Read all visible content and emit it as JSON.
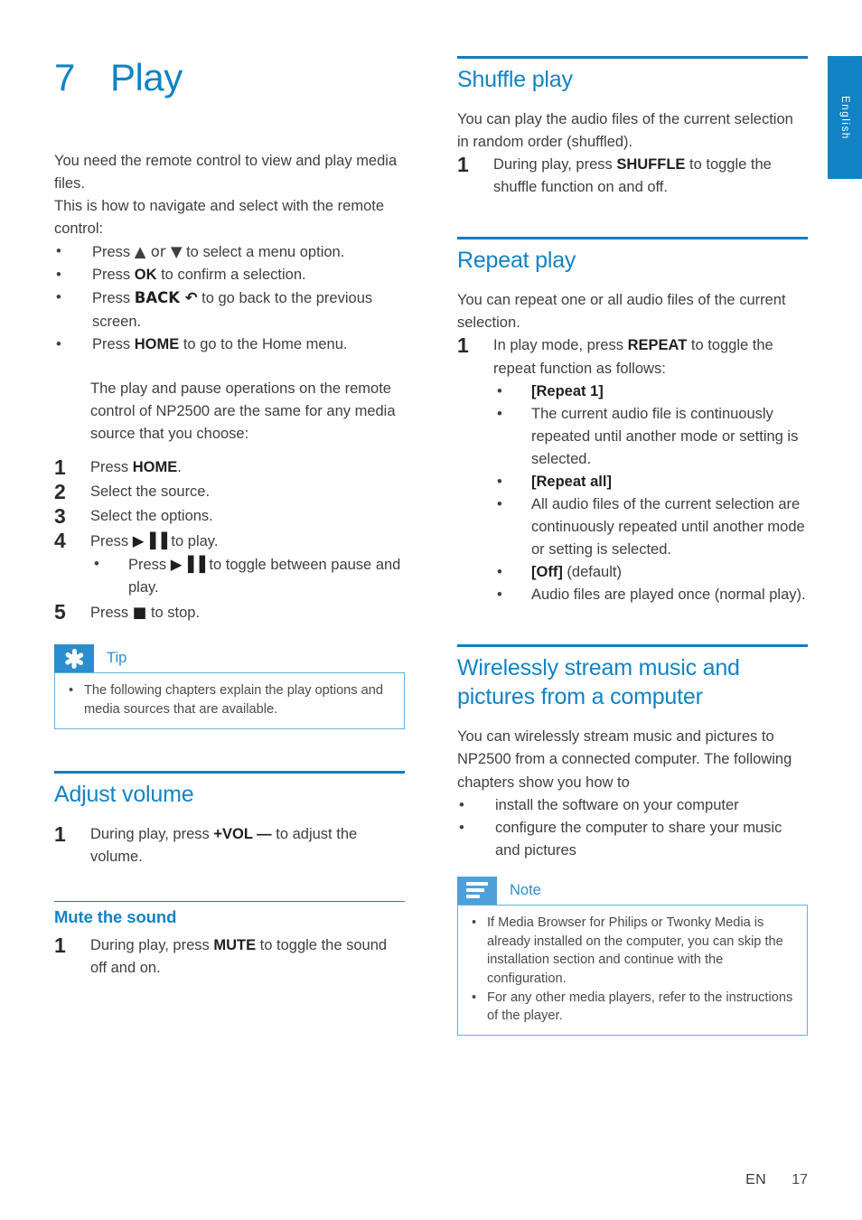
{
  "colors": {
    "accent_blue": "#1283c4",
    "rule_blue": "#0f7cc0",
    "callout_icon_blue": "#4f9fd8",
    "callout_border": "#6aaedd",
    "body_text": "#3f3f3f"
  },
  "chapter": {
    "number": "7",
    "title": "Play"
  },
  "language_tab": {
    "label": "English"
  },
  "footer": {
    "language_code": "EN",
    "page_number": "17"
  },
  "left_column": {
    "intro": {
      "paragraph_1": "You need the remote control to view and play media files.",
      "paragraph_2": "This is how to navigate and select with the remote control:"
    },
    "nav_bullets": [
      {
        "prefix": "Press ",
        "key": "▲ or ▼",
        "key_bold": false,
        "suffix": " to select a menu option."
      },
      {
        "prefix": "Press ",
        "key": "OK",
        "key_bold": true,
        "suffix": " to confirm a selection."
      },
      {
        "prefix": "Press ",
        "key": "BACK ↶",
        "key_bold": true,
        "suffix": " to go back to the previous screen."
      },
      {
        "prefix": "Press ",
        "key": "HOME",
        "key_bold": true,
        "suffix": " to go to the Home menu."
      }
    ],
    "note_paragraph": "The play and pause operations on the remote control of NP2500 are the same for any media source that you choose:",
    "steps": [
      {
        "num": "1",
        "prefix": "Press ",
        "key": "HOME",
        "key_bold": true,
        "suffix": "."
      },
      {
        "num": "2",
        "prefix": "Select the source.",
        "key": "",
        "key_bold": false,
        "suffix": ""
      },
      {
        "num": "3",
        "prefix": "Select the options.",
        "key": "",
        "key_bold": false,
        "suffix": ""
      },
      {
        "num": "4",
        "prefix": "Press ",
        "key": "▶▐▐",
        "key_bold": true,
        "suffix": " to play."
      },
      {
        "num": "5",
        "prefix": "Press ",
        "key": "■",
        "key_bold": true,
        "suffix": " to stop."
      }
    ],
    "step4_sub_bullet": {
      "prefix": "Press ",
      "key": "▶▐▐",
      "suffix": " to toggle between pause and play."
    },
    "tip_box": {
      "icon": "asterisk-icon",
      "label": "Tip",
      "items": [
        "The following chapters explain the play options and media sources that are available."
      ]
    },
    "adjust_volume": {
      "heading": "Adjust volume",
      "steps": [
        {
          "num": "1",
          "prefix": "During play, press ",
          "key": "+VOL —",
          "key_bold": true,
          "suffix": " to adjust the volume."
        }
      ]
    },
    "mute_the_sound": {
      "heading": "Mute the sound",
      "steps": [
        {
          "num": "1",
          "prefix": "During play, press ",
          "key": "MUTE",
          "key_bold": true,
          "suffix": " to toggle the sound off and on."
        }
      ]
    }
  },
  "right_column": {
    "shuffle_play": {
      "heading": "Shuffle play",
      "paragraph": "You can play the audio files of the current selection in random order (shuffled).",
      "steps": [
        {
          "num": "1",
          "prefix": "During play, press ",
          "key": "SHUFFLE",
          "key_bold": true,
          "suffix": " to toggle the shuffle function on and off."
        }
      ]
    },
    "repeat_play": {
      "heading": "Repeat play",
      "paragraph": "You can repeat one or all audio files of the current selection.",
      "steps": [
        {
          "num": "1",
          "prefix": "In play mode, press ",
          "key": "REPEAT",
          "key_bold": true,
          "suffix": " to toggle the repeat function as follows:"
        }
      ],
      "options": [
        {
          "bold": "[Repeat 1]",
          "rest": ""
        },
        {
          "bold": "",
          "rest": "The current audio file is continuously repeated until another mode or setting is selected."
        },
        {
          "bold": "[Repeat all]",
          "rest": ""
        },
        {
          "bold": "",
          "rest": "All audio files of the current selection are continuously repeated until another mode or setting is selected."
        },
        {
          "bold": "[Off]",
          "rest": " (default)"
        },
        {
          "bold": "",
          "rest": "Audio files are played once (normal play)."
        }
      ]
    },
    "wireless_stream": {
      "heading": "Wirelessly stream music and pictures from a computer",
      "paragraph": "You can wirelessly stream music and pictures to NP2500 from a connected computer. The following chapters show you how to",
      "bullets": [
        "install the software on your computer",
        "configure the computer to share your music and pictures"
      ],
      "note_box": {
        "icon": "lines-icon",
        "label": "Note",
        "items": [
          "If Media Browser for Philips or Twonky Media is already installed on the computer, you can skip the installation section and continue with the configuration.",
          "For any other media players, refer to the instructions of the player."
        ]
      }
    }
  }
}
